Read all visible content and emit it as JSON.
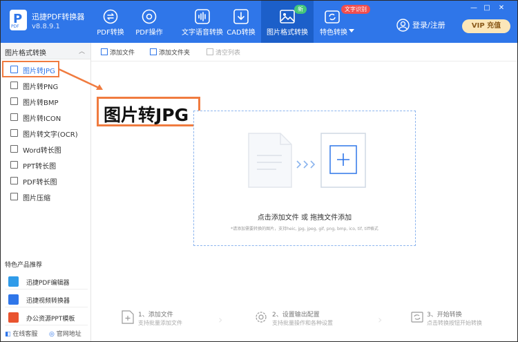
{
  "app": {
    "name": "迅捷PDF转换器",
    "version": "v8.8.9.1",
    "logo_letter": "P",
    "logo_sub": "PDF"
  },
  "nav": [
    {
      "label": "PDF转换",
      "icon": "convert-icon"
    },
    {
      "label": "PDF操作",
      "icon": "settings-icon"
    },
    {
      "label": "文字语音转换",
      "icon": "audio-wave-icon"
    },
    {
      "label": "CAD转换",
      "icon": "cad-icon"
    },
    {
      "label": "图片格式转换",
      "icon": "image-icon",
      "badge": "新",
      "active": true
    },
    {
      "label": "特色转换",
      "icon": "refresh-box-icon",
      "badge": "文字识别",
      "dropdown": true
    }
  ],
  "header": {
    "login_label": "登录/注册",
    "vip_label": "VIP 充值"
  },
  "window": {
    "minimize": "—",
    "maximize": "□",
    "close": "✕"
  },
  "sidebar": {
    "section_title": "图片格式转换",
    "items": [
      {
        "label": "图片转JPG",
        "selected": true
      },
      {
        "label": "图片转PNG"
      },
      {
        "label": "图片转BMP"
      },
      {
        "label": "图片转ICON"
      },
      {
        "label": "图片转文字(OCR)"
      },
      {
        "label": "Word转长图"
      },
      {
        "label": "PPT转长图"
      },
      {
        "label": "PDF转长图"
      },
      {
        "label": "图片压缩"
      }
    ],
    "featured_title": "特色产品推荐",
    "featured": [
      {
        "label": "迅捷PDF编辑器",
        "color": "#2f9be9"
      },
      {
        "label": "迅捷视频转换器",
        "color": "#2f76e9"
      },
      {
        "label": "办公资源PPT模板",
        "color": "#e9532f"
      }
    ],
    "footer_left": "在线客服",
    "footer_right": "官网地址"
  },
  "toolbar": {
    "add_file": "添加文件",
    "add_folder": "添加文件夹",
    "clear_list": "清空列表"
  },
  "annotation": {
    "title": "图片转JPG"
  },
  "dropzone": {
    "main_text": "点击添加文件 或 拖拽文件添加",
    "sub_text": "*请添加需要转换的图片，支持heic, jpg, jpeg, gif, png, bmp, ico, tif, tiff格式"
  },
  "steps": [
    {
      "title": "1、添加文件",
      "desc": "支持批量添加文件"
    },
    {
      "title": "2、设置输出配置",
      "desc": "支持批量操作和各种设置"
    },
    {
      "title": "3、开始转换",
      "desc": "点击转换按钮开始转换"
    }
  ],
  "colors": {
    "brand_blue": "#2f76e9",
    "annotation_orange": "#f07b3f",
    "vip_gold": "#fbe6b9"
  }
}
